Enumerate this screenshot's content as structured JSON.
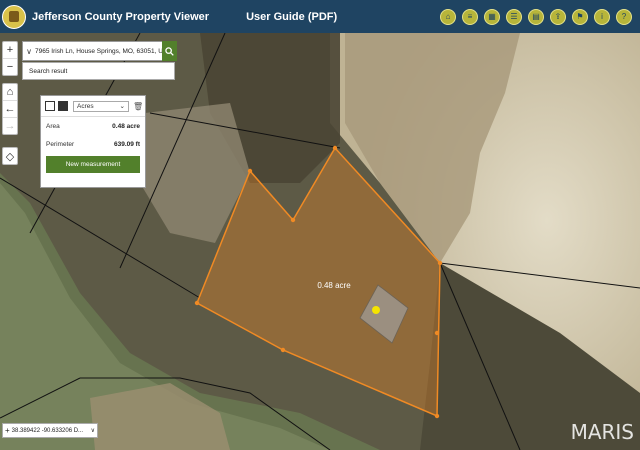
{
  "header": {
    "app_title": "Jefferson County Property Viewer",
    "guide_link": "User Guide (PDF)",
    "tools": [
      "home-tool-icon",
      "layers-tool-icon",
      "basemap-tool-icon",
      "legend-tool-icon",
      "print-tool-icon",
      "share-tool-icon",
      "bookmark-tool-icon",
      "info-tool-icon",
      "help-tool-icon"
    ]
  },
  "map_controls": {
    "zoom_in": "+",
    "zoom_out": "−"
  },
  "search": {
    "value": "7965 Irish Ln, House Springs, MO, 63051, USA",
    "result_label": "Search result"
  },
  "measurement": {
    "unit": "Acres",
    "area_label": "Area",
    "area_value": "0.48 acre",
    "perimeter_label": "Perimeter",
    "perimeter_value": "639.09 ft",
    "new_button": "New measurement"
  },
  "map": {
    "polygon_label": "0.48 acre"
  },
  "coordinates": "38.389422 -90.633206 D...",
  "watermark": "MARIS",
  "colors": {
    "header_bg": "#1f4462",
    "accent_green": "#52802b",
    "polygon_stroke": "#f08a24"
  }
}
